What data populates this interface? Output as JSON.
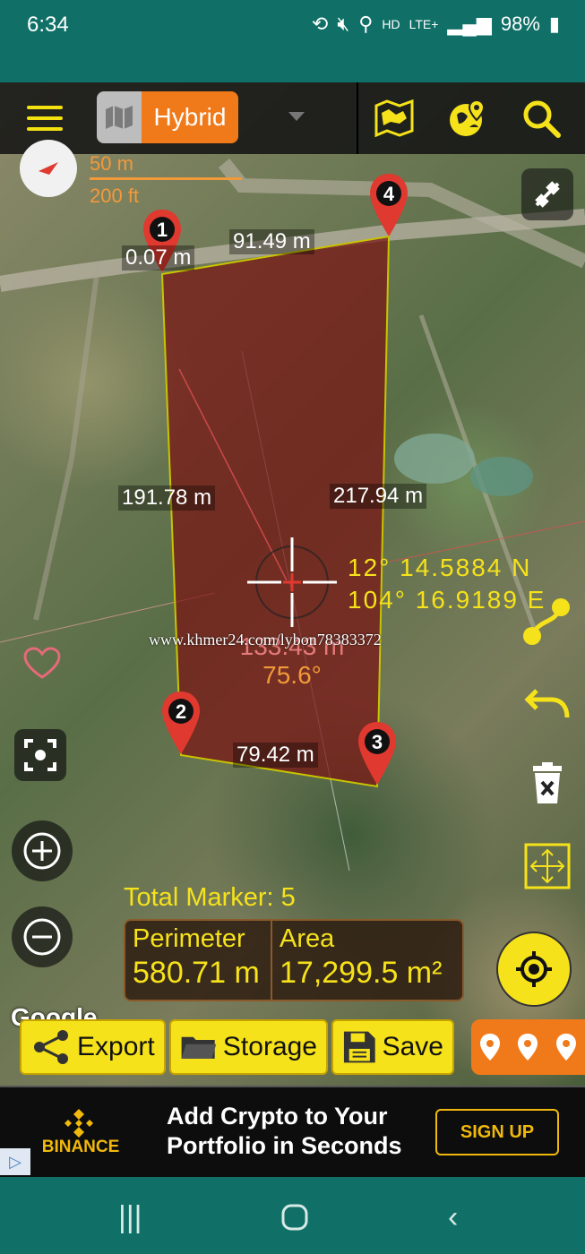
{
  "status": {
    "time": "6:34",
    "network": "HD",
    "lte": "LTE+",
    "battery": "98%"
  },
  "toolbar": {
    "map_type": "Hybrid",
    "icons": [
      "menu-icon",
      "map-layers-icon",
      "globe-pin-icon",
      "search-icon"
    ]
  },
  "scale": {
    "metric": "50 m",
    "imperial": "200 ft"
  },
  "markers": [
    "1",
    "2",
    "3",
    "4"
  ],
  "segments": {
    "first": "0.07 m",
    "top": "91.49 m",
    "left": "191.78 m",
    "right": "217.94 m",
    "bottom": "79.42 m"
  },
  "crosshair": {
    "lat": "12° 14.5884 N",
    "lon": "104° 16.9189 E",
    "distance": "133.43 m",
    "bearing": "75.6°"
  },
  "watermark": "www.khmer24.com/lybon78383372",
  "summary": {
    "total_marker_label": "Total Marker:",
    "total_marker_value": "5",
    "perimeter_label": "Perimeter",
    "perimeter_value": "580.71 m",
    "area_label": "Area",
    "area_value": "17,299.5 m²"
  },
  "google_logo": "Google",
  "actions": {
    "export": "Export",
    "storage": "Storage",
    "save": "Save"
  },
  "ad": {
    "brand": "BINANCE",
    "line1": "Add Crypto to Your",
    "line2": "Portfolio in Seconds",
    "cta": "SIGN UP"
  },
  "colors": {
    "accent": "#f6e21a",
    "orange": "#f07a1a",
    "polygon": "#7a1414",
    "statusbar": "#107067",
    "pin": "#e0392f"
  }
}
